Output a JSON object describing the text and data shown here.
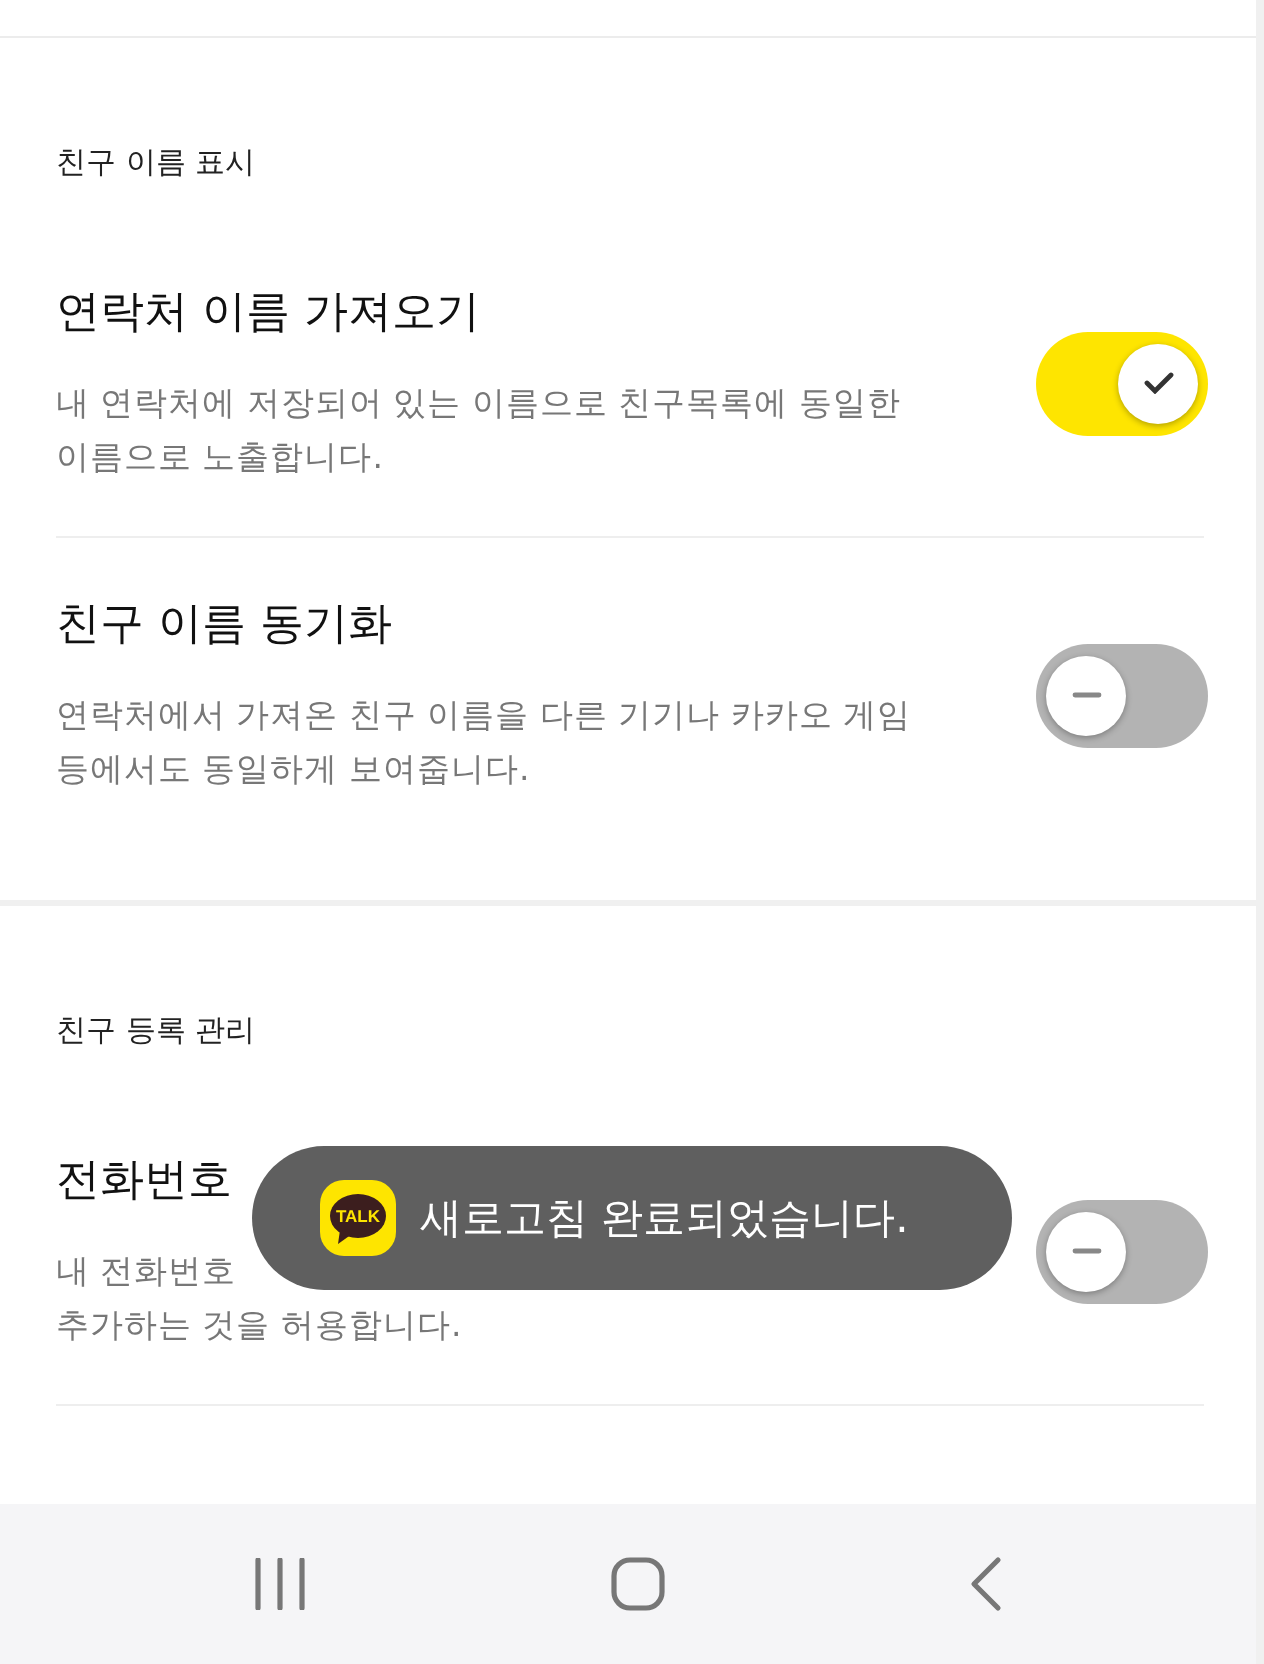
{
  "sections": [
    {
      "header": "친구 이름 표시",
      "items": [
        {
          "kind": "toggle",
          "title": "연락처 이름 가져오기",
          "description": "내 연락처에 저장되어 있는 이름으로 친구목록에 동일한\n이름으로 노출합니다.",
          "on": true
        },
        {
          "kind": "toggle",
          "title": "친구 이름 동기화",
          "description": "연락처에서 가져온 친구 이름을 다른 기기나 카카오 게임\n등에서도 동일하게 보여줍니다.",
          "on": false
        }
      ]
    },
    {
      "header": "친구 등록 관리",
      "items": [
        {
          "kind": "toggle",
          "title": "전화번호",
          "description": "내 전화번호\n추가하는 것을 허용합니다.",
          "on": false
        }
      ]
    }
  ],
  "toast": {
    "icon_label": "TALK",
    "message": "새로고침 완료되었습니다."
  }
}
